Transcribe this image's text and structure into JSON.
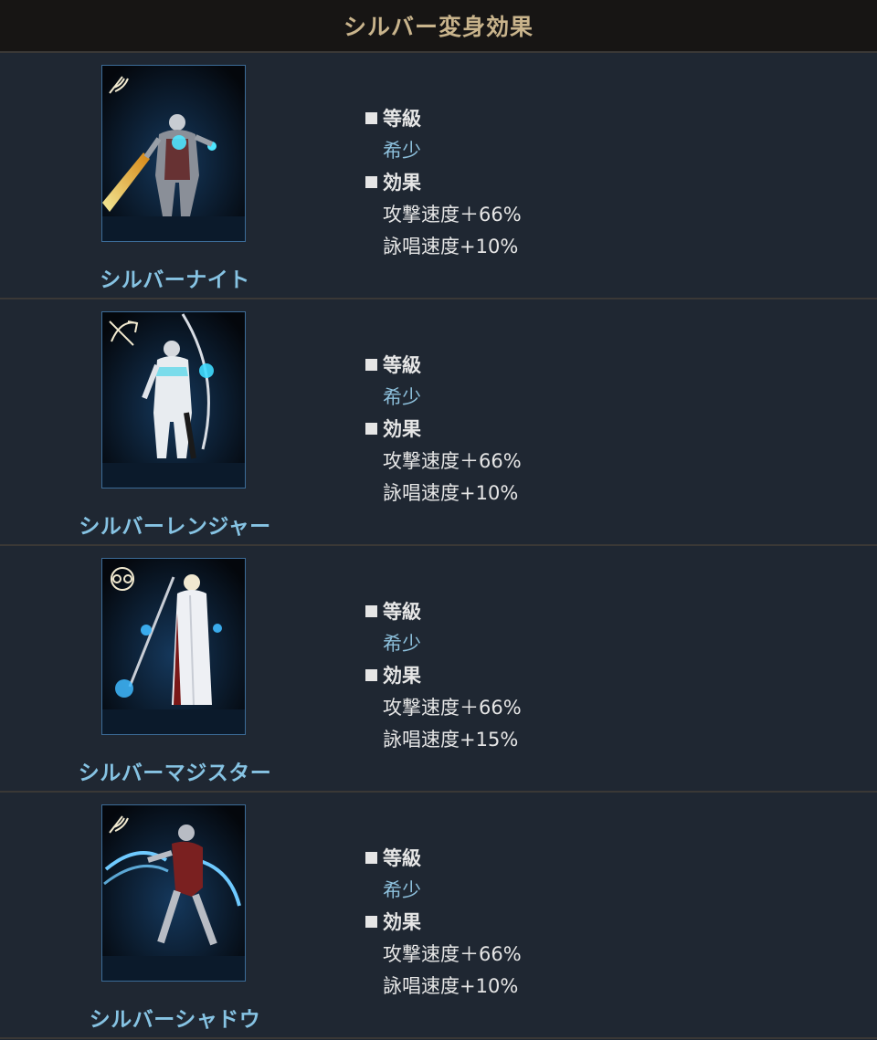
{
  "header": {
    "title": "シルバー変身効果"
  },
  "labels": {
    "grade": "等級",
    "effect": "効果"
  },
  "forms": [
    {
      "name": "シルバーナイト",
      "class_icon": "sword-wing-icon",
      "grade": "希少",
      "effects": [
        "攻撃速度＋66%",
        "詠唱速度+10%"
      ]
    },
    {
      "name": "シルバーレンジャー",
      "class_icon": "bow-icon",
      "grade": "希少",
      "effects": [
        "攻撃速度＋66%",
        "詠唱速度+10%"
      ]
    },
    {
      "name": "シルバーマジスター",
      "class_icon": "magic-orb-icon",
      "grade": "希少",
      "effects": [
        "攻撃速度＋66%",
        "詠唱速度+15%"
      ]
    },
    {
      "name": "シルバーシャドウ",
      "class_icon": "sword-wing-icon",
      "grade": "希少",
      "effects": [
        "攻撃速度＋66%",
        "詠唱速度+10%"
      ]
    }
  ]
}
